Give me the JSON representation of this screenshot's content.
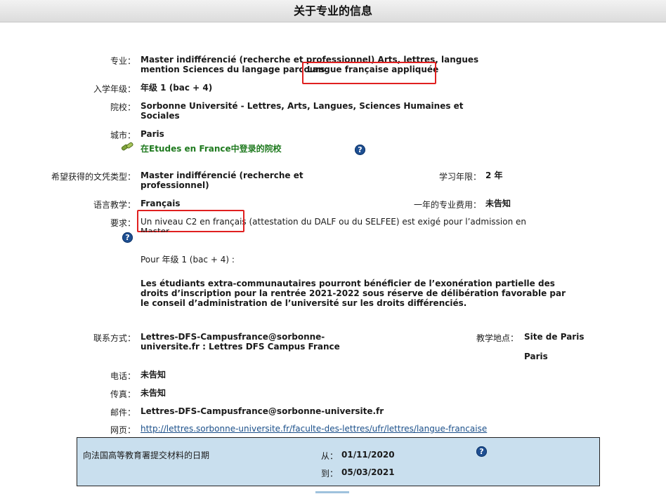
{
  "header": {
    "title": "关于专业的信息"
  },
  "program": {
    "specialty_label": "专业：",
    "specialty_line1": "Master indifférencié (recherche et professionnel) Arts, lettres, langues",
    "specialty_line2_prefix": "mention Sciences du langage parcours",
    "specialty_line2_highlight": "Langue française appliquée",
    "year_label": "入学年级：",
    "year_value": "年级 1 (bac + 4)",
    "school_label": "院校：",
    "school_line1": "Sorbonne Université - Lettres, Arts, Langues, Sciences Humaines et",
    "school_line2": "Sociales",
    "city_label": "城市：",
    "city_value": "Paris",
    "ef_link": "在Etudes en France中登录的院校",
    "diploma_label": "希望获得的文凭类型：",
    "diploma_line1": "Master indifférencié (recherche et",
    "diploma_line2": "professionnel)",
    "duration_label": "学习年限：",
    "duration_value": "2 年",
    "language_label": "语言教学：",
    "language_value": "Français",
    "fee_label": "一年的专业费用：",
    "fee_value": "未告知",
    "requirements_label": "要求：",
    "req_highlight": "Un niveau C2 en français",
    "req_rest": " (attestation du DALF ou du SELFEE) est exigé pour l’admission en",
    "req_line2": "Master.",
    "req_year": "Pour 年级 1 (bac + 4) :",
    "req_bold_line1": "Les étudiants extra-communautaires pourront bénéficier de l’exonération partielle des",
    "req_bold_line2": "droits d’inscription pour la rentrée 2021-2022 sous réserve de délibération favorable par",
    "req_bold_line3": "le conseil d’administration de l’université sur les droits différenciés."
  },
  "contact": {
    "contact_label": "联系方式：",
    "contact_line1": "Lettres-DFS-Campusfrance@sorbonne-",
    "contact_line2": "universite.fr : Lettres DFS Campus France",
    "site_label": "教学地点：",
    "site_value": "Site de Paris",
    "site_city": "Paris",
    "phone_label": "电话：",
    "phone_value": "未告知",
    "fax_label": "传真：",
    "fax_value": "未告知",
    "email_label": "邮件：",
    "email_value": "Lettres-DFS-Campusfrance@sorbonne-universite.fr",
    "web_label": "网页：",
    "web_value": "http://lettres.sorbonne-universite.fr/faculte-des-lettres/ufr/lettres/langue-francaise"
  },
  "dates": {
    "label": "向法国高等教育署提交材料的日期",
    "from_label": "从：",
    "from_value": "01/11/2020",
    "to_label": "到：",
    "to_value": "05/03/2021"
  },
  "icons": {
    "help": "help-icon",
    "link": "link-icon"
  },
  "colors": {
    "highlight_border": "#e02020",
    "help_icon": "#1e4f92",
    "link_green": "#1f7a1f",
    "date_panel": "#c9dfee"
  }
}
